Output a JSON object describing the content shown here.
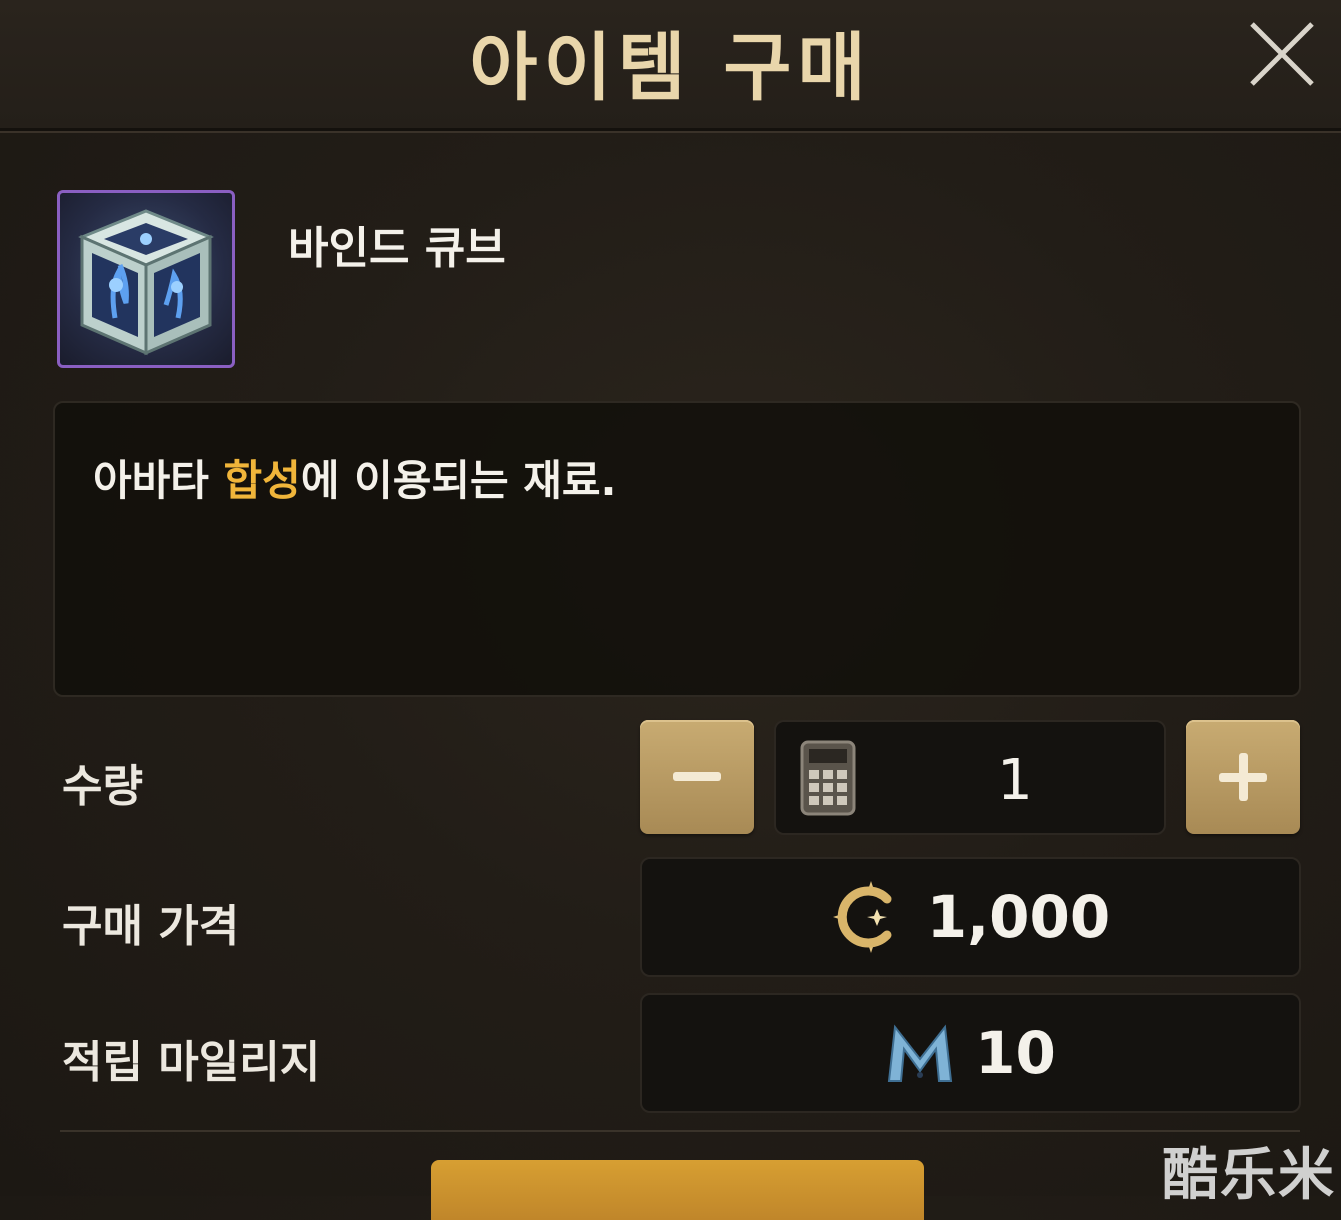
{
  "header": {
    "title": "아이템 구매"
  },
  "item": {
    "name": "바인드 큐브",
    "description_parts": [
      "아바타 ",
      "합성",
      "에 이용되는 재료."
    ]
  },
  "quantity": {
    "label": "수량",
    "value": "1"
  },
  "price": {
    "label": "구매 가격",
    "value": "1,000",
    "currency_icon": "gold-coin-icon"
  },
  "mileage": {
    "label": "적립 마일리지",
    "value": "10",
    "icon": "mileage-m-icon"
  },
  "colors": {
    "accent_gold": "#c8ab72",
    "highlight": "#f0b53a",
    "buy_button": "#d79f32",
    "icon_border": "#8a5fc2"
  },
  "watermark": "酷乐米"
}
